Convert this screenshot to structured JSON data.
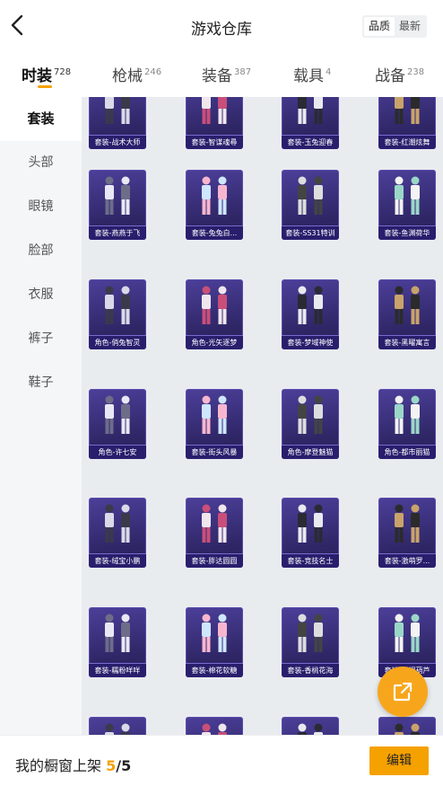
{
  "header": {
    "back_icon": "chevron-left-icon",
    "title": "游戏仓库",
    "sort_options": [
      "品质",
      "最新"
    ],
    "sort_selected": "品质"
  },
  "tabs": [
    {
      "label": "时装",
      "count": "728",
      "active": true
    },
    {
      "label": "枪械",
      "count": "246",
      "active": false
    },
    {
      "label": "装备",
      "count": "387",
      "active": false
    },
    {
      "label": "载具",
      "count": "4",
      "active": false
    },
    {
      "label": "战备",
      "count": "238",
      "active": false
    }
  ],
  "sidebar": {
    "items": [
      "套装",
      "头部",
      "眼镜",
      "脸部",
      "衣服",
      "裤子",
      "鞋子"
    ],
    "active": "套装"
  },
  "items": [
    {
      "name": "套装-战术大师"
    },
    {
      "name": "套装-智谋魂尋"
    },
    {
      "name": "套装-玉兔迎春"
    },
    {
      "name": "套装-红潮炫舞"
    },
    {
      "name": "套装-燕燕于飞"
    },
    {
      "name": "套装-兔兔白..."
    },
    {
      "name": "套装-SS31特训"
    },
    {
      "name": "套装-鱼渊荷华"
    },
    {
      "name": "角色-俏兔智灵"
    },
    {
      "name": "角色-光矢逐梦"
    },
    {
      "name": "套装-梦域神使"
    },
    {
      "name": "套装-黑曜寓言"
    },
    {
      "name": "角色-许七安"
    },
    {
      "name": "套装-街头风暴"
    },
    {
      "name": "角色-摩登魅猫"
    },
    {
      "name": "角色-都市丽猫"
    },
    {
      "name": "套装-绒宝小鹏"
    },
    {
      "name": "套装-胖达圆圆"
    },
    {
      "name": "套装-竞技名士"
    },
    {
      "name": "套装-激萌罗..."
    },
    {
      "name": "套装-糯粉咩咩"
    },
    {
      "name": "套装-棉花软糖"
    },
    {
      "name": "套装-香桃花海"
    },
    {
      "name": "套装-梧桐葫芦"
    },
    {
      "name": ""
    },
    {
      "name": ""
    },
    {
      "name": ""
    },
    {
      "name": ""
    }
  ],
  "fab": {
    "icon": "share-external-icon"
  },
  "footer": {
    "shelf_label": "我的橱窗上架",
    "shelf_current": "5",
    "shelf_separator": "/",
    "shelf_total": "5",
    "edit_label": "编辑"
  },
  "colors": {
    "accent": "#f5a100",
    "card_bg": "#3c2f7d",
    "sidebar_bg": "#f4f6f8",
    "grid_bg": "#e9ecef"
  }
}
